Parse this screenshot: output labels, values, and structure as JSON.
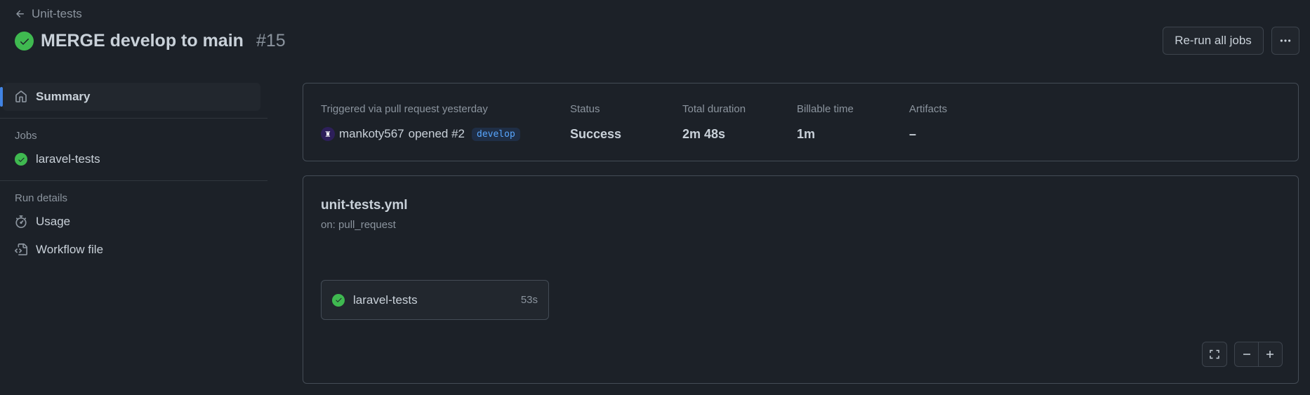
{
  "header": {
    "back_label": "Unit-tests",
    "title": "MERGE develop to main",
    "run_number": "#15",
    "rerun_label": "Re-run all jobs",
    "more_icon": "kebab-horizontal-icon"
  },
  "sidebar": {
    "summary_label": "Summary",
    "jobs_heading": "Jobs",
    "jobs": [
      {
        "label": "laravel-tests",
        "status": "success"
      }
    ],
    "run_details_heading": "Run details",
    "run_details": [
      {
        "label": "Usage",
        "icon": "stopwatch-icon"
      },
      {
        "label": "Workflow file",
        "icon": "file-code-icon"
      }
    ]
  },
  "summary": {
    "trigger_label": "Triggered via pull request yesterday",
    "actor": "mankoty567",
    "action": "opened #2",
    "branch": "develop",
    "status_label": "Status",
    "status_value": "Success",
    "duration_label": "Total duration",
    "duration_value": "2m 48s",
    "billable_label": "Billable time",
    "billable_value": "1m",
    "artifacts_label": "Artifacts",
    "artifacts_value": "–"
  },
  "workflow": {
    "file_name": "unit-tests.yml",
    "trigger": "on: pull_request",
    "job": {
      "name": "laravel-tests",
      "duration": "53s",
      "status": "success"
    }
  },
  "colors": {
    "background": "#1c2128",
    "success": "#3fb950",
    "accent": "#4184e4",
    "branch_bg": "#1f2e46",
    "branch_text": "#58a6ff"
  }
}
